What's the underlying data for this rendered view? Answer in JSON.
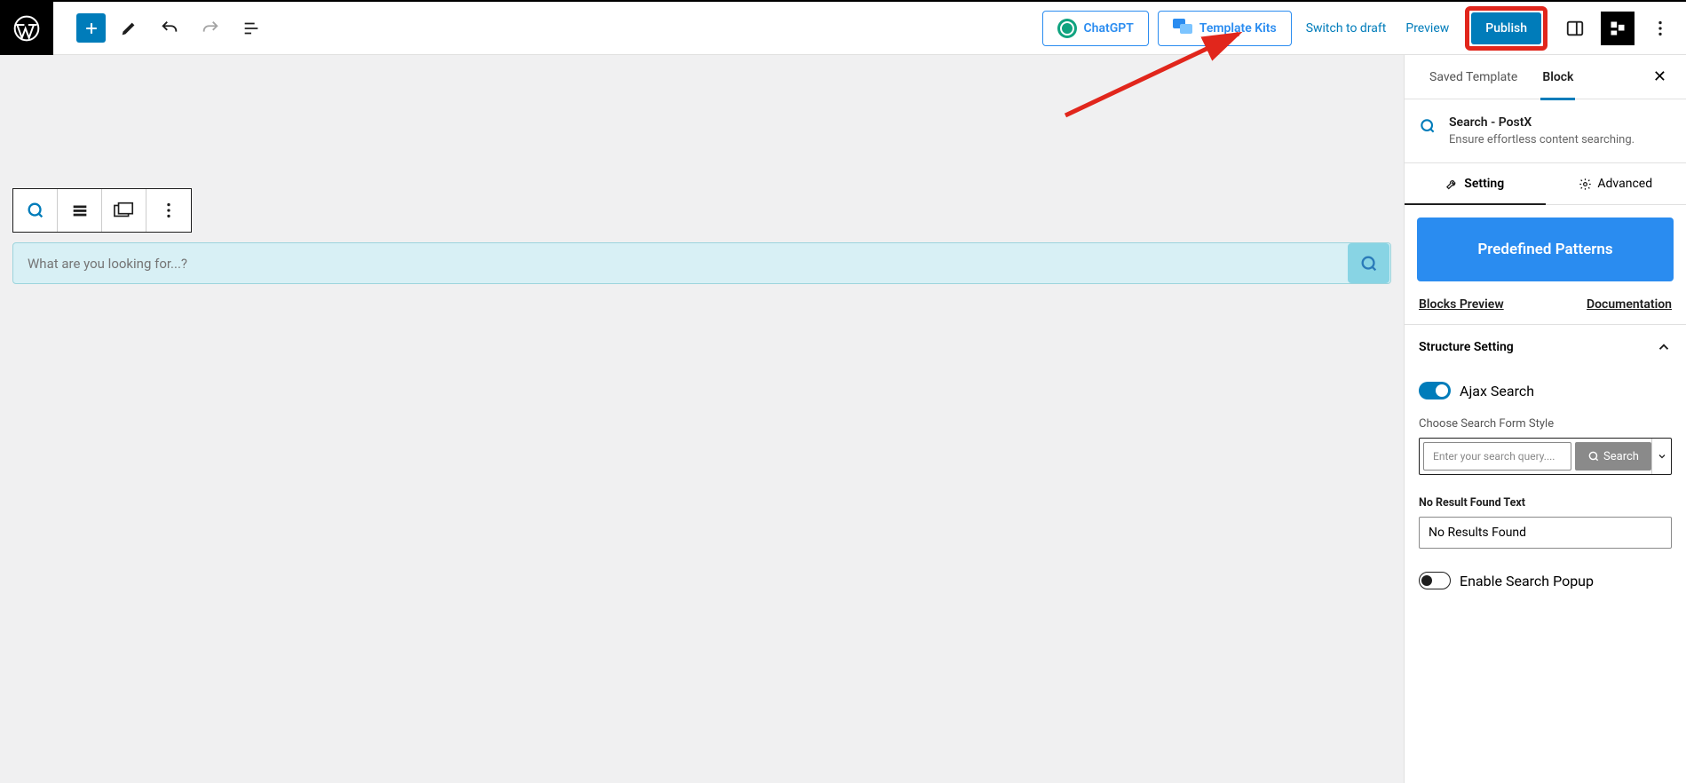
{
  "toolbar": {
    "chatgpt_label": "ChatGPT",
    "template_kits_label": "Template Kits",
    "switch_draft": "Switch to draft",
    "preview": "Preview",
    "publish": "Publish"
  },
  "editor": {
    "search_placeholder": "What are you looking for...?"
  },
  "sidebar": {
    "tabs": {
      "saved_template": "Saved Template",
      "block": "Block"
    },
    "block_title": "Search - PostX",
    "block_desc": "Ensure effortless content searching.",
    "inner_tabs": {
      "setting": "Setting",
      "advanced": "Advanced"
    },
    "predefined_btn": "Predefined Patterns",
    "links": {
      "blocks_preview": "Blocks Preview",
      "documentation": "Documentation"
    },
    "structure": {
      "title": "Structure Setting",
      "ajax_search": "Ajax Search",
      "choose_style": "Choose Search Form Style",
      "style_placeholder": "Enter your search query....",
      "style_btn": "Search",
      "no_result_label": "No Result Found Text",
      "no_result_value": "No Results Found",
      "enable_popup": "Enable Search Popup"
    }
  }
}
